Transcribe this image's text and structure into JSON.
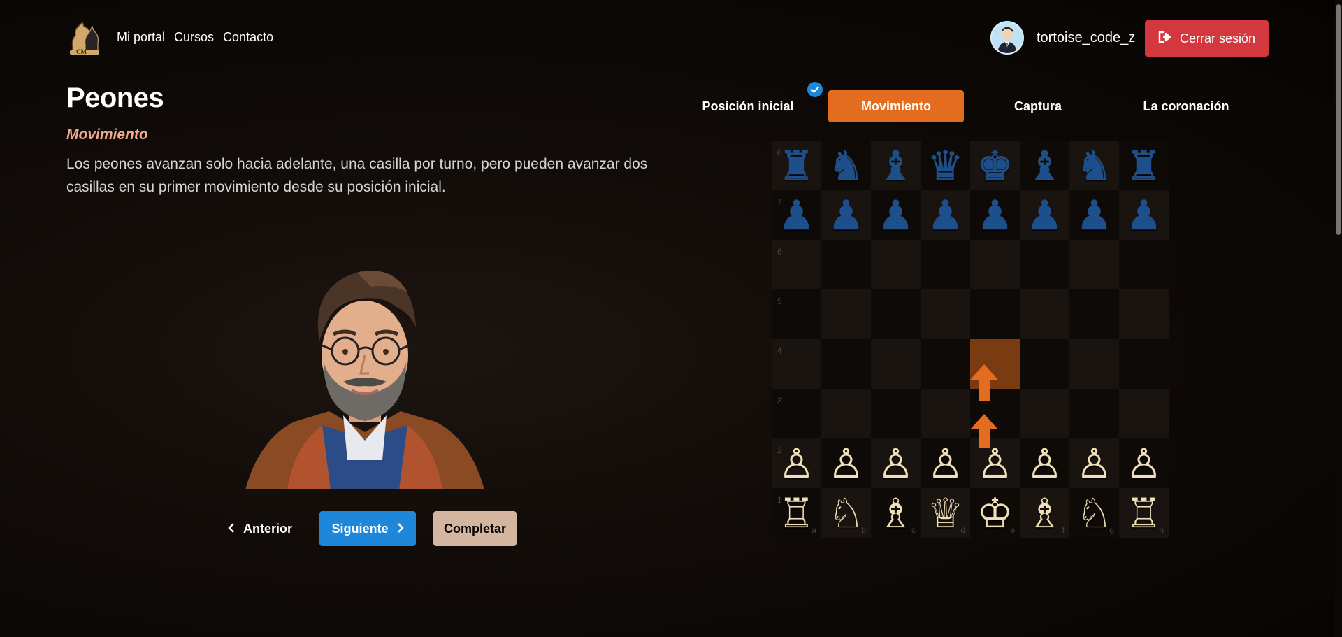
{
  "header": {
    "nav": [
      "Mi portal",
      "Cursos",
      "Contacto"
    ],
    "username": "tortoise_code_z",
    "logout_label": "Cerrar sesión"
  },
  "lesson": {
    "title": "Peones",
    "subtitle": "Movimiento",
    "description": "Los peones avanzan solo hacia adelante, una casilla por turno, pero pueden avanzar dos casillas en su primer movimiento desde su posición inicial."
  },
  "buttons": {
    "prev": "Anterior",
    "next": "Siguiente",
    "complete": "Completar"
  },
  "tabs": [
    {
      "label": "Posición inicial",
      "completed": true
    },
    {
      "label": "Movimiento",
      "active": true
    },
    {
      "label": "Captura"
    },
    {
      "label": "La coronación"
    }
  ],
  "board": {
    "ranks": [
      "8",
      "7",
      "6",
      "5",
      "4",
      "3",
      "2",
      "1"
    ],
    "files": [
      "a",
      "b",
      "c",
      "d",
      "e",
      "f",
      "g",
      "h"
    ],
    "rows": [
      [
        "♜",
        "♞",
        "♝",
        "♛",
        "♚",
        "♝",
        "♞",
        "♜"
      ],
      [
        "♟",
        "♟",
        "♟",
        "♟",
        "♟",
        "♟",
        "♟",
        "♟"
      ],
      [
        "",
        "",
        "",
        "",
        "",
        "",
        "",
        ""
      ],
      [
        "",
        "",
        "",
        "",
        "",
        "",
        "",
        ""
      ],
      [
        "",
        "",
        "",
        "",
        "",
        "",
        "",
        ""
      ],
      [
        "",
        "",
        "",
        "",
        "",
        "",
        "",
        ""
      ],
      [
        "♙",
        "♙",
        "♙",
        "♙",
        "♙",
        "♙",
        "♙",
        "♙"
      ],
      [
        "♖",
        "♘",
        "♗",
        "♕",
        "♔",
        "♗",
        "♘",
        "♖"
      ]
    ],
    "highlight_square": "e4",
    "move_arrows": "e2 → e4",
    "colors": {
      "black_pieces": "#1c4f8c",
      "white_pieces": "#efe0b9",
      "highlight": "#7a3a12",
      "arrow": "#e36c1f"
    }
  },
  "colors": {
    "accent_orange": "#e36c1f",
    "primary_blue": "#1f87da",
    "danger_red": "#d3383f",
    "complete_tan": "#d3b5a0",
    "subtitle": "#f0a98a"
  }
}
